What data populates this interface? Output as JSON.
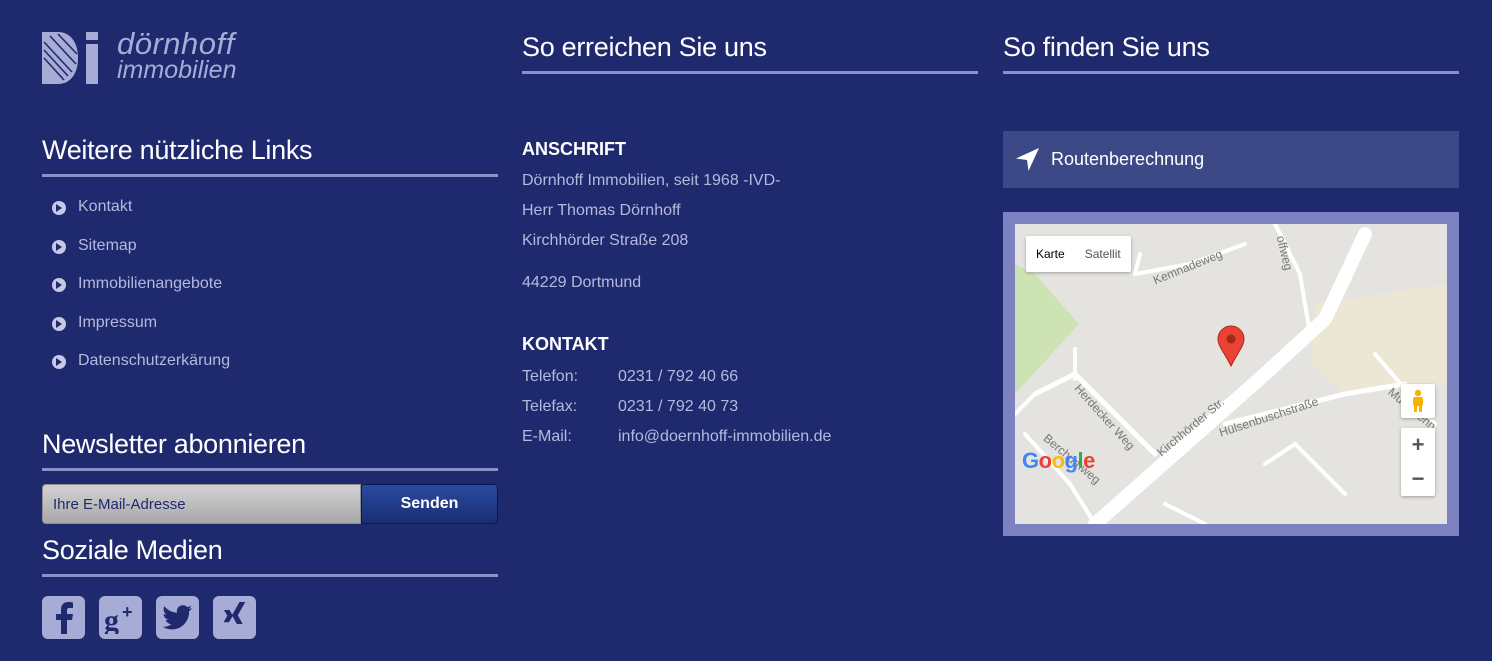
{
  "logo": {
    "line1": "dörnhoff",
    "line2": "immobilien"
  },
  "links_section": {
    "title": "Weitere nützliche Links",
    "items": [
      "Kontakt",
      "Sitemap",
      "Immobilienangebote",
      "Impressum",
      "Datenschutzerkärung"
    ]
  },
  "newsletter": {
    "title": "Newsletter abonnieren",
    "placeholder": "Ihre E-Mail-Adresse",
    "button": "Senden"
  },
  "social": {
    "title": "Soziale Medien",
    "icons": [
      "facebook-icon",
      "google-plus-icon",
      "twitter-icon",
      "xing-icon"
    ]
  },
  "reach": {
    "title": "So erreichen Sie uns",
    "address_label": "ANSCHRIFT",
    "address_lines": [
      "Dörnhoff Immobilien, seit 1968 -IVD-",
      "Herr Thomas Dörnhoff",
      "Kirchhörder Straße 208",
      "44229 Dortmund"
    ],
    "contact_label": "KONTAKT",
    "contacts": [
      {
        "key": "Telefon:",
        "value": "0231 / 792 40 66"
      },
      {
        "key": "Telefax:",
        "value": "0231 / 792 40 73"
      },
      {
        "key": "E-Mail:",
        "value": "info@doernhoff-immobilien.de"
      }
    ]
  },
  "find": {
    "title": "So finden Sie uns",
    "route": "Routenberechnung",
    "map": {
      "toggle_map": "Karte",
      "toggle_satellite": "Satellit",
      "streets": [
        "Kemnadeweg",
        "offweg",
        "Herdecker Weg",
        "Kirchhörder Str.",
        "Hülsenbuschstraße",
        "Berchumweg",
        "Mu·erpenn"
      ],
      "zoom_in": "+",
      "zoom_out": "−"
    }
  },
  "colors": {
    "background": "#1f2a6e",
    "accent": "#a7acd6",
    "rule": "#8a90c8",
    "marker": "#ea4335"
  }
}
